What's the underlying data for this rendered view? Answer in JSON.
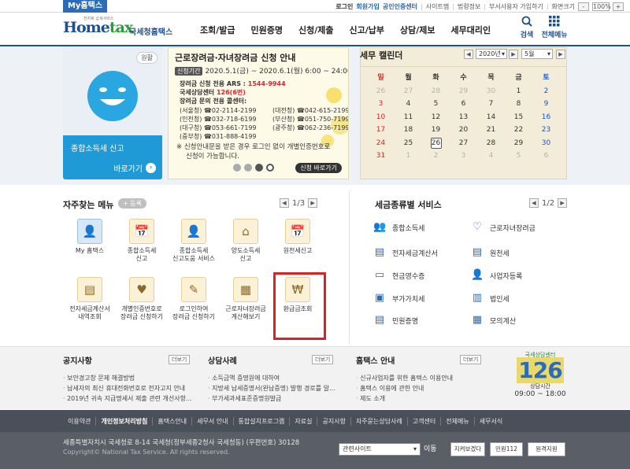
{
  "topbar": {
    "my_tab": "My홈택스",
    "login": "로그인",
    "signup": "회원가입",
    "cert_center": "공인인증센터",
    "sitemap": "사이트맵",
    "legal": "법령정보",
    "dept_signup": "부서사용자 가입하기",
    "screen_size": "화면크기",
    "zoom": "100%",
    "minus": "-",
    "plus": "+"
  },
  "header": {
    "logo_main_a": "Home",
    "logo_main_b": "tax",
    "logo_sub": "국세청홈택스",
    "logo_tiny": "전자로 납세서비스",
    "menu": [
      "조회/발급",
      "민원증명",
      "신청/제출",
      "신고/납부",
      "상담/제보",
      "세무대리인"
    ],
    "search": "검색",
    "all_menu": "전체메뉴"
  },
  "hero": {
    "card_badge": "원활",
    "card_title": "종합소득세 신고",
    "card_go": "바로가기",
    "card_go_icon": "›",
    "banner_title": "근로장려금·자녀장려금 신청 안내",
    "banner_period_tag": "신청기간",
    "banner_period": "2020.5.1(금) ~ 2020.6.1(월) 6:00 ~ 24:00",
    "banner_ars_label": "장려금 신청 전용 ARS :",
    "banner_ars_num": "1544-9944",
    "banner_center_label": "국세상담센터",
    "banner_center_num": "126(6번)",
    "banner_inquiry": "장려금 문의 전용 콜센터:",
    "banner_calls": [
      [
        "(서울청) ☎02-2114-2199",
        "(대전청) ☎042-615-2199"
      ],
      [
        "(인천청) ☎032-718-6199",
        "(부산청) ☎051-750-7199"
      ],
      [
        "(대구청) ☎053-661-7199",
        "(광주청) ☎062-236-7199"
      ],
      [
        "(중부청) ☎031-888-4199",
        ""
      ]
    ],
    "banner_note1": "※ 신청안내문을 받은 경우 로그인 없이 개별인증번호로",
    "banner_note2": "신청이 가능합니다.",
    "banner_apply": "신청 바로가기",
    "calendar": {
      "title": "세무 캘린더",
      "year": "2020년",
      "month": "5월",
      "prev": "◀",
      "next": "▶",
      "weekdays": [
        "일",
        "월",
        "화",
        "수",
        "목",
        "금",
        "토"
      ],
      "weeks": [
        [
          "26",
          "27",
          "28",
          "29",
          "30",
          "1",
          "2"
        ],
        [
          "3",
          "4",
          "5",
          "6",
          "7",
          "8",
          "9"
        ],
        [
          "10",
          "11",
          "12",
          "13",
          "14",
          "15",
          "16"
        ],
        [
          "17",
          "18",
          "19",
          "20",
          "21",
          "22",
          "23"
        ],
        [
          "24",
          "25",
          "26",
          "27",
          "28",
          "29",
          "30"
        ],
        [
          "31",
          "1",
          "2",
          "3",
          "4",
          "5",
          "6"
        ]
      ],
      "today": "26"
    }
  },
  "frequent": {
    "title": "자주찾는 메뉴",
    "register": "+ 등록",
    "page": "1/3",
    "prev": "◀",
    "next": "▶",
    "items": [
      {
        "label1": "My 홈택스",
        "label2": "",
        "icon": "👤"
      },
      {
        "label1": "종합소득세",
        "label2": "신고",
        "icon": "📅"
      },
      {
        "label1": "종합소득세",
        "label2": "신고도움 서비스",
        "icon": "👤"
      },
      {
        "label1": "양도소득세",
        "label2": "신고",
        "icon": "⌂"
      },
      {
        "label1": "원천세신고",
        "label2": "",
        "icon": "📅"
      },
      {
        "label1": "전자세금계산서",
        "label2": "내역조회",
        "icon": "▤"
      },
      {
        "label1": "개별인증번호로",
        "label2": "장려금 신청하기",
        "icon": "♥"
      },
      {
        "label1": "로그인하여",
        "label2": "장려금 신청하기",
        "icon": "✎"
      },
      {
        "label1": "근로자녀장려금",
        "label2": "계산해보기",
        "icon": "▦"
      },
      {
        "label1": "환급금조회",
        "label2": "",
        "icon": "₩"
      }
    ]
  },
  "tax_services": {
    "title": "세금종류별 서비스",
    "page": "1/2",
    "prev": "◀",
    "next": "▶",
    "items": [
      {
        "label": "종합소득세",
        "icon": "👥"
      },
      {
        "label": "근로자녀장려금",
        "icon": "♡"
      },
      {
        "label": "전자세금계산서",
        "icon": "▤"
      },
      {
        "label": "원천세",
        "icon": "▤"
      },
      {
        "label": "현금영수증",
        "icon": "▭"
      },
      {
        "label": "사업자등록",
        "icon": "👤"
      },
      {
        "label": "부가가치세",
        "icon": "▣"
      },
      {
        "label": "법인세",
        "icon": "▥"
      },
      {
        "label": "민원증명",
        "icon": "▤"
      },
      {
        "label": "모의계산",
        "icon": "▦"
      }
    ]
  },
  "board": {
    "notice_title": "공지사항",
    "notice_items": [
      "보안경고창 문제 해결방법",
      "납세자의 최신 휴대전화번호로 전자고지 안내",
      "2019년 귀속 지급명세서 제출 관련 개선사항..."
    ],
    "case_title": "상담사례",
    "case_items": [
      "소득금액 증명원에 대하여",
      "지방세 납세증명서(완납증명) 발행 경로를 알...",
      "부가세과세표준증명원발급"
    ],
    "guide_title": "홈택스 안내",
    "guide_items": [
      "신규사업자를 위한 홈택스 이용안내",
      "홈택스 이용에 관한 안내",
      "제도 소개"
    ],
    "more": "더보기",
    "center_label": "국세상담센터",
    "center_num": "126",
    "center_hours_label": "상담시간",
    "center_hours": "09:00 ~ 18:00"
  },
  "footer": {
    "links": [
      "이용약관",
      "개인정보처리방침",
      "홈택스안내",
      "세무서 안내",
      "통합설치프로그램",
      "자료실",
      "공지사항",
      "자주묻는상담사례",
      "고객센터",
      "전체메뉴",
      "세무서식"
    ],
    "address": "세종특별자치시 국세청로 8-14 국세청(정부세종2청사 국세청동) (우편번호) 30128",
    "copyright": "Copyright© National Tax Service. All rights reserved.",
    "related_sites": "관련사이트",
    "go": "이동",
    "btn1": "지켜보겠다",
    "btn2": "민원112",
    "btn3": "원격지원"
  },
  "colors": {
    "brand": "#1e4f91",
    "accent": "#1f9ad6",
    "highlight": "#e02020"
  }
}
